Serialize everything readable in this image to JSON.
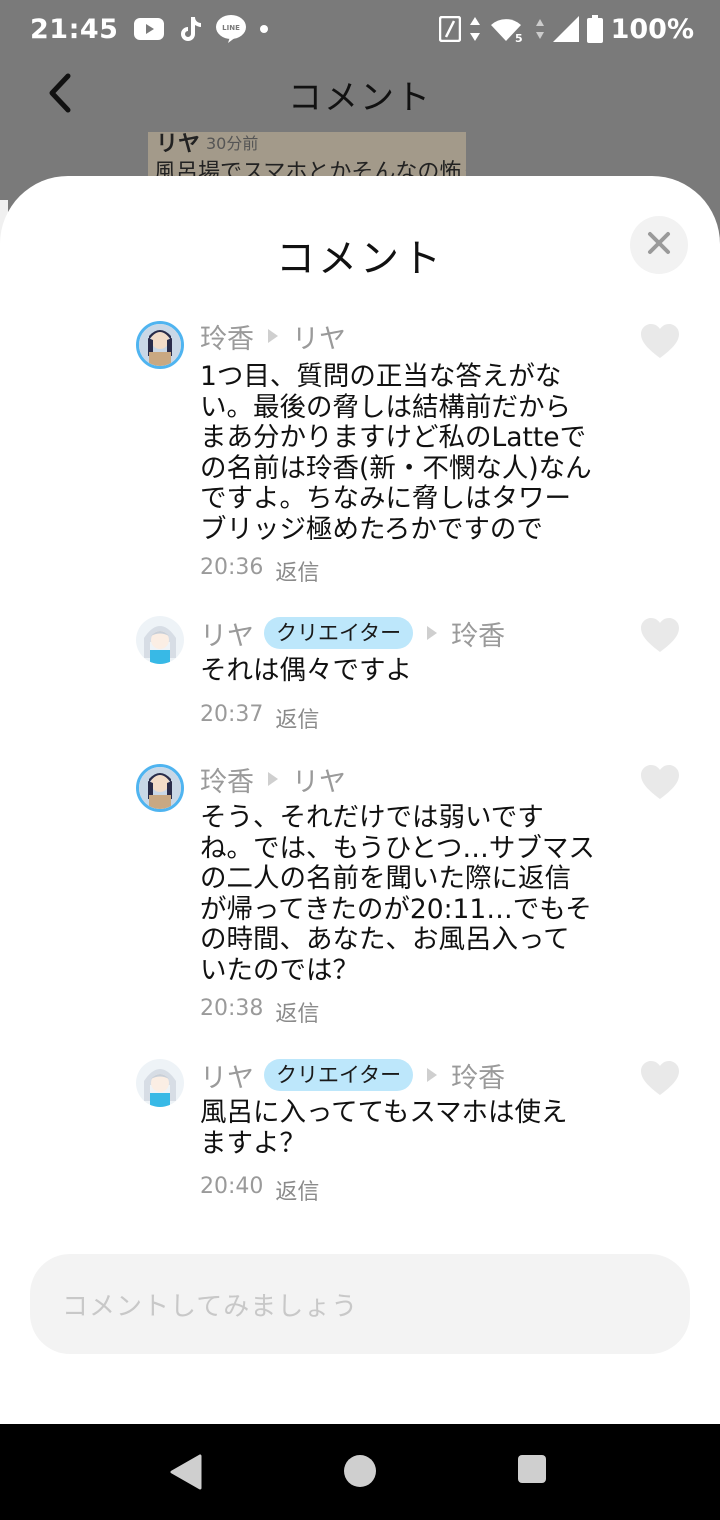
{
  "status_bar": {
    "time": "21:45",
    "battery": "100%",
    "network": "5"
  },
  "background": {
    "title": "コメント",
    "peek_name": "リヤ",
    "peek_time": "30分前",
    "peek_text": "風呂場でスマホとかそんなの怖く"
  },
  "sheet": {
    "title": "コメント",
    "input_placeholder": "コメントしてみましょう"
  },
  "comments": [
    {
      "author": "玲香",
      "reply_to": "リヤ",
      "badge": "",
      "text": "1つ目、質問の正当な答えがな\nい。最後の脅しは結構前だから\nまあ分かりますけど私のLatteで\nの名前は玲香(新・不憫な人)なん\nですよ。ちなみに脅しはタワー\nブリッジ極めたろかですので",
      "time": "20:36",
      "reply_label": "返信"
    },
    {
      "author": "リヤ",
      "badge": "クリエイター",
      "reply_to": "玲香",
      "text": "それは偶々ですよ",
      "time": "20:37",
      "reply_label": "返信"
    },
    {
      "author": "玲香",
      "reply_to": "リヤ",
      "badge": "",
      "text": "そう、それだけでは弱いです\nね。では、もうひとつ…サブマス\nの二人の名前を聞いた際に返信\nが帰ってきたのが20:11…でもそ\nの時間、あなた、お風呂入って\nいたのでは？",
      "time": "20:38",
      "reply_label": "返信"
    },
    {
      "author": "リヤ",
      "badge": "クリエイター",
      "reply_to": "玲香",
      "text": "風呂に入っててもスマホは使え\nますよ？",
      "time": "20:40",
      "reply_label": "返信"
    }
  ],
  "colors": {
    "badge_bg": "#bde7fb",
    "avatar_ring": "#4fb4f0",
    "sheet_bg": "#ffffff",
    "scrim": "#7a7a7a"
  }
}
